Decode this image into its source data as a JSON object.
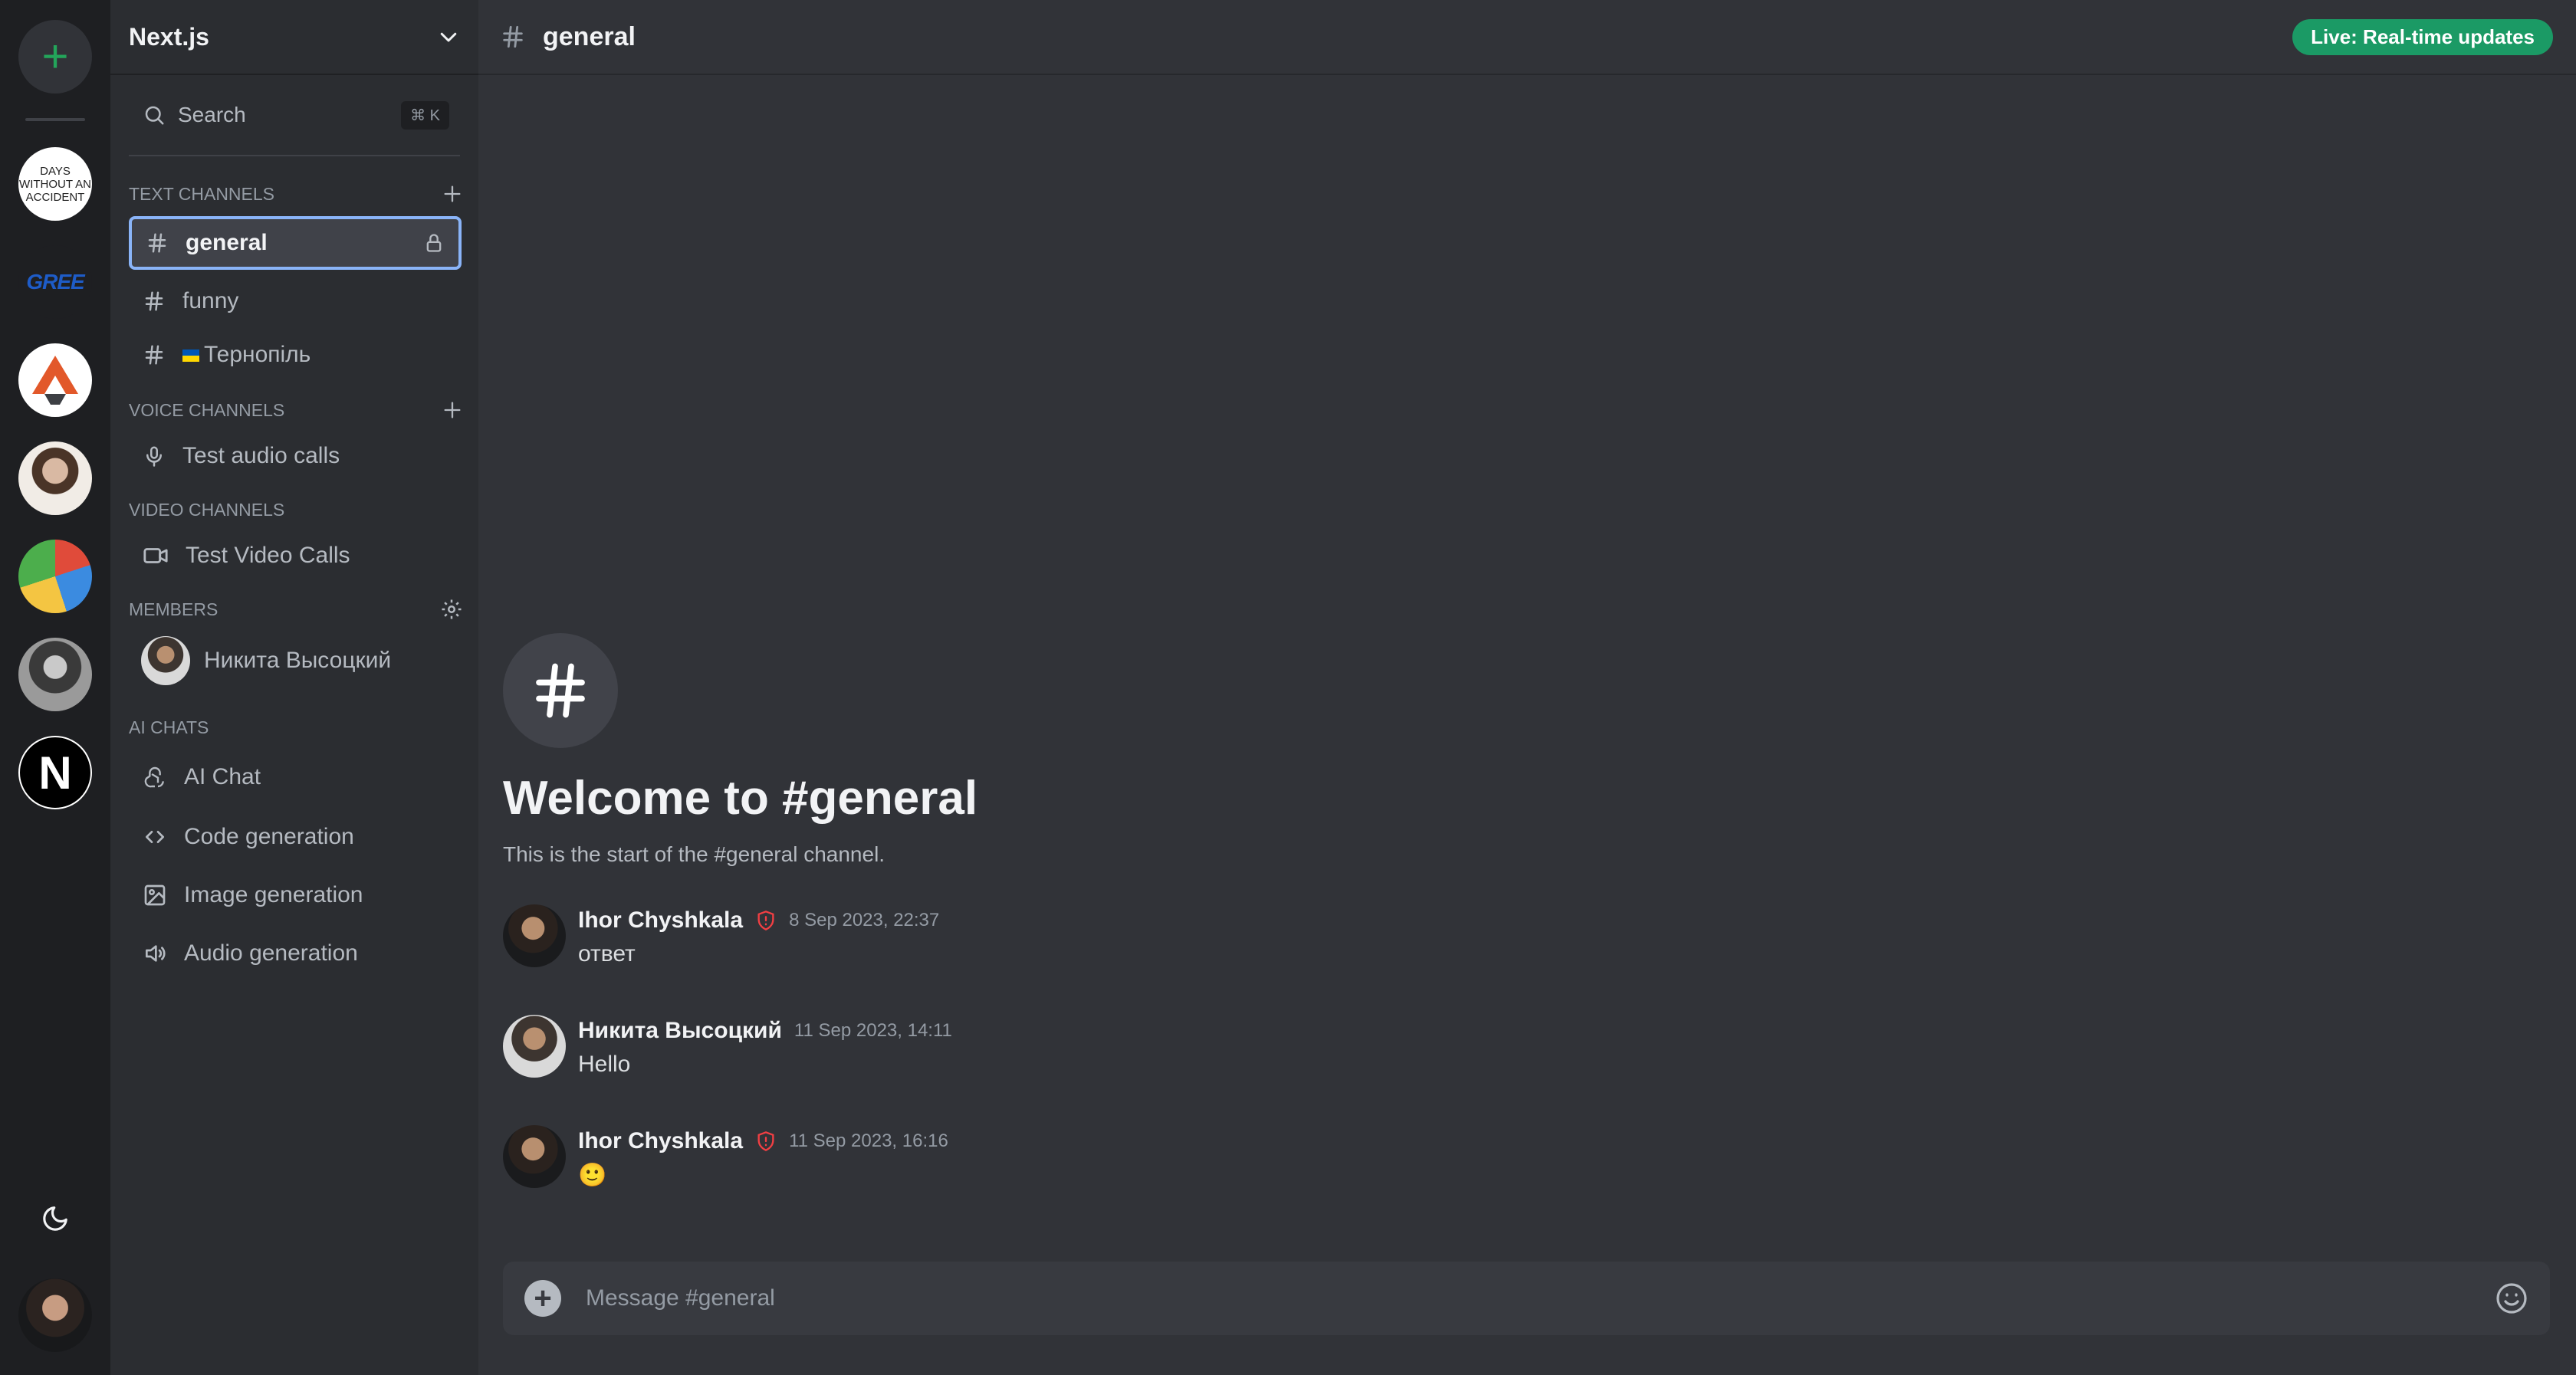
{
  "rail": {
    "add_icon": "plus-icon",
    "servers": [
      {
        "name": "days-without-accident",
        "label": "DAYS WITHOUT AN ACCIDENT"
      },
      {
        "name": "gree",
        "label": "GREE"
      },
      {
        "name": "geometric-logo",
        "label": ""
      },
      {
        "name": "woman-portrait",
        "label": ""
      },
      {
        "name": "kids-drawing",
        "label": ""
      },
      {
        "name": "man-portrait",
        "label": ""
      },
      {
        "name": "nextjs",
        "label": "N",
        "active": true
      }
    ],
    "theme_icon": "moon-icon"
  },
  "sidebar": {
    "server_name": "Next.js",
    "search_label": "Search",
    "search_shortcut": "⌘ K",
    "text_channels_title": "TEXT CHANNELS",
    "text_channels": [
      {
        "label": "general",
        "active": true
      },
      {
        "label": "funny"
      },
      {
        "label": "Тернопіль",
        "flag": "ukraine"
      }
    ],
    "voice_channels_title": "VOICE CHANNELS",
    "voice_channels": [
      {
        "label": "Test audio calls"
      }
    ],
    "video_channels_title": "VIDEO CHANNELS",
    "video_channels": [
      {
        "label": "Test Video Calls"
      }
    ],
    "members_title": "MEMBERS",
    "members": [
      {
        "label": "Никита Высоцкий"
      }
    ],
    "ai_title": "AI CHATS",
    "ai_chats": [
      {
        "label": "AI Chat",
        "icon": "openai-icon"
      },
      {
        "label": "Code generation",
        "icon": "code-icon"
      },
      {
        "label": "Image generation",
        "icon": "image-icon"
      },
      {
        "label": "Audio generation",
        "icon": "speaker-icon"
      }
    ]
  },
  "main": {
    "channel": "general",
    "live_badge": "Live: Real-time updates",
    "welcome_title": "Welcome to #general",
    "welcome_subtitle": "This is the start of the #general channel.",
    "messages": [
      {
        "author": "Ihor Chyshkala",
        "badge": "shield-alert-icon",
        "time": "8 Sep 2023, 22:37",
        "text": "ответ"
      },
      {
        "author": "Никита Высоцкий",
        "time": "11 Sep 2023, 14:11",
        "text": "Hello"
      },
      {
        "author": "Ihor Chyshkala",
        "badge": "shield-alert-icon",
        "time": "11 Sep 2023, 16:16",
        "text": "🙂"
      }
    ],
    "composer_placeholder": "Message #general"
  },
  "colors": {
    "rail_bg": "#1e1f22",
    "sidebar_bg": "#2b2d31",
    "main_bg": "#313338",
    "live_badge": "#1b9a65",
    "active_outline": "#8ab4f8",
    "admin_shield": "#f23f43"
  }
}
